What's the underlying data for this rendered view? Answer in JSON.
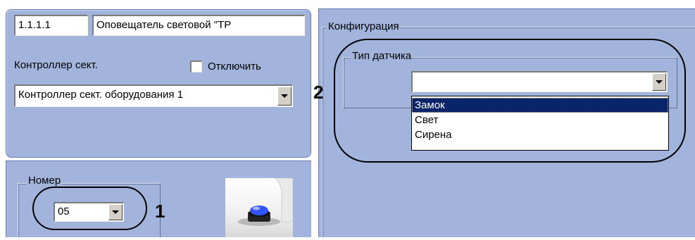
{
  "device": {
    "id": "1.1.1.1",
    "name": "Оповещатель световой \"ТР"
  },
  "controller": {
    "label": "Контроллер сект.",
    "disable_label": "Отключить",
    "selected": "Контроллер сект. оборудования 1"
  },
  "number": {
    "group_label": "Номер",
    "value": "05",
    "callout": "1"
  },
  "config": {
    "group_label": "Конфигурация",
    "sensor_type": {
      "group_label": "Тип датчика",
      "value": "",
      "options": [
        "Замок",
        "Свет",
        "Сирена"
      ],
      "callout": "2"
    }
  },
  "icons": {
    "dropdown": "chevron-down-icon",
    "checkbox": "checkbox-icon",
    "preview": "light-siren-device-icon"
  },
  "colors": {
    "panel": "#a2b4dc",
    "selection": "#0a246a",
    "button": "#d4d0c8",
    "siren": "#3355ff"
  }
}
